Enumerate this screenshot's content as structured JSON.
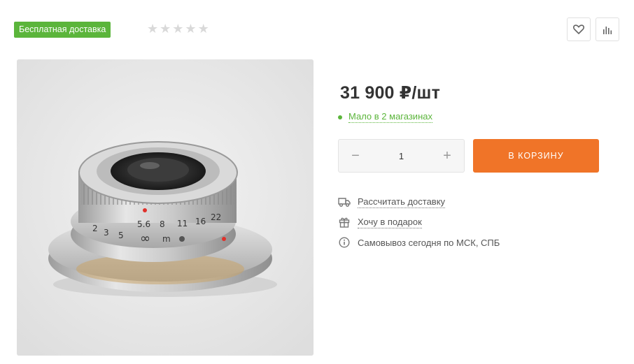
{
  "badge": {
    "label": "Бесплатная доставка",
    "color": "#5bb53b"
  },
  "rating": {
    "stars": [
      "★",
      "★",
      "★",
      "★",
      "★"
    ],
    "value": 0,
    "max": 5
  },
  "actions": {
    "favorite_icon": "heart-icon",
    "compare_icon": "bar-chart-icon"
  },
  "product": {
    "image_alt": "lens-photo",
    "lens_scale": [
      "5.6",
      "8",
      "11",
      "16",
      "22"
    ],
    "lens_distance": [
      "2",
      "3",
      "5",
      "∞",
      "m"
    ]
  },
  "price": {
    "text": "31 900 ₽/шт"
  },
  "stock": {
    "text": "Мало в 2 магазинах",
    "color": "#5bb53b"
  },
  "quantity": {
    "minus": "−",
    "value": "1",
    "plus": "+"
  },
  "cart": {
    "label": "В КОРЗИНУ",
    "color": "#f07428"
  },
  "info": {
    "delivery": "Рассчитать доставку",
    "gift": "Хочу в подарок",
    "pickup": "Самовывоз сегодня по МСК, СПБ"
  }
}
